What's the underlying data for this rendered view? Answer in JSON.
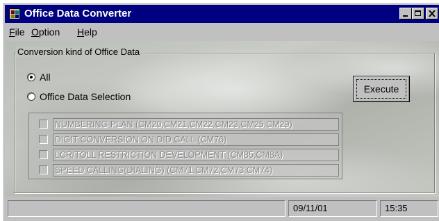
{
  "window": {
    "title": "Office Data Converter",
    "icon": "app-window-icon",
    "controls": [
      "minimize-icon",
      "restore-icon",
      "close-icon"
    ]
  },
  "menu": {
    "items": [
      {
        "label": "File",
        "mnemonic": "F"
      },
      {
        "label": "Option",
        "mnemonic": "O"
      },
      {
        "label": "Help",
        "mnemonic": "H"
      }
    ]
  },
  "conversion": {
    "group_label": "Conversion kind of Office Data",
    "radio_all": "All",
    "radio_selection": "Office Data Selection",
    "selected": "All",
    "execute_label": "Execute",
    "options": [
      {
        "label": "NUMBERING PLAN (CM20,CM21,CM22,CM23,CM25,CM29)",
        "checked": false,
        "enabled": false
      },
      {
        "label": "DIGIT CONVERSION ON DID CALL (CM76)",
        "checked": false,
        "enabled": false
      },
      {
        "label": "LCR/TOLL RESTRICTION DEVELOPMENT (CM85,CM8A)",
        "checked": false,
        "enabled": false
      },
      {
        "label": "SPEED CALLING(DIALING) (CM71,CM72,CM73,CM74)",
        "checked": false,
        "enabled": false
      }
    ]
  },
  "status": {
    "message": "",
    "date": "09/11/01",
    "time": "15:35"
  },
  "colors": {
    "titlebar": "#000080",
    "face": "#c0c0c0",
    "disabled_text": "#8a8a8a"
  }
}
